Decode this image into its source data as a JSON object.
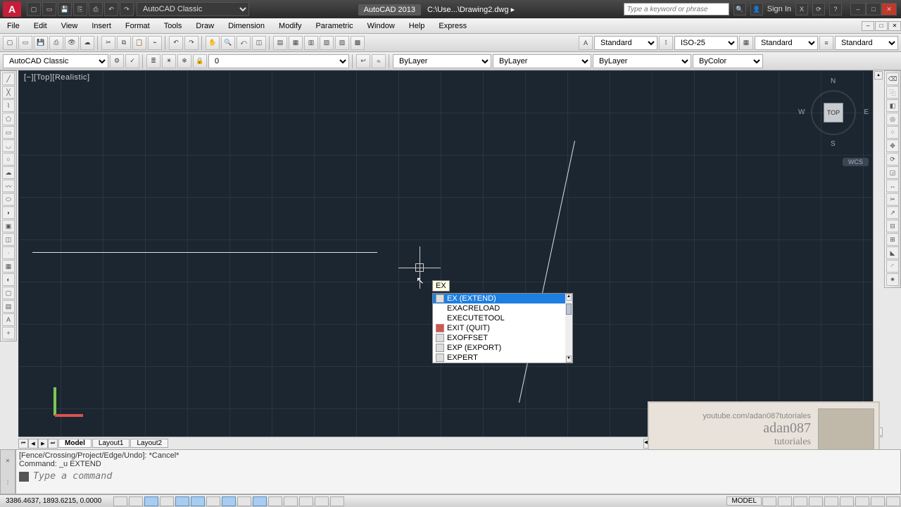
{
  "title": {
    "app_name": "AutoCAD 2013",
    "file_path": "C:\\Use...\\Drawing2.dwg",
    "search_placeholder": "Type a keyword or phrase",
    "sign_in": "Sign In",
    "workspace_qat": "AutoCAD Classic"
  },
  "menus": [
    "File",
    "Edit",
    "View",
    "Insert",
    "Format",
    "Tools",
    "Draw",
    "Dimension",
    "Modify",
    "Parametric",
    "Window",
    "Help",
    "Express"
  ],
  "toolbar1": {
    "workspace": "AutoCAD Classic",
    "layer_value": "0",
    "txt_style": "Standard",
    "dim_style": "ISO-25",
    "tbl_style": "Standard",
    "ml_style": "Standard"
  },
  "properties": {
    "layer": "ByLayer",
    "linetype": "ByLayer",
    "lineweight": "ByLayer",
    "color": "ByColor"
  },
  "viewport_label": "[−][Top][Realistic]",
  "viewcube": {
    "n": "N",
    "s": "S",
    "e": "E",
    "w": "W",
    "top": "TOP",
    "wcs": "WCS"
  },
  "layout_tabs": {
    "active": "Model",
    "tabs": [
      "Model",
      "Layout1",
      "Layout2"
    ]
  },
  "command": {
    "line1": "[Fence/Crossing/Project/Edge/Undo]: *Cancel*",
    "line2": "Command: _u EXTEND",
    "placeholder": "Type a command"
  },
  "dyn_input": "EX",
  "autocomplete": [
    {
      "label": "EX (EXTEND)",
      "selected": true
    },
    {
      "label": "EXACRELOAD"
    },
    {
      "label": "EXECUTETOOL"
    },
    {
      "label": "EXIT (QUIT)"
    },
    {
      "label": "EXOFFSET"
    },
    {
      "label": "EXP (EXPORT)"
    },
    {
      "label": "EXPERT"
    }
  ],
  "status": {
    "coords": "3386.4637, 1893.6215, 0.0000",
    "model": "MODEL"
  },
  "overlay": {
    "line1": "youtube.com/adan087tutoriales",
    "line2": "adan087",
    "line3": "tutoriales"
  }
}
